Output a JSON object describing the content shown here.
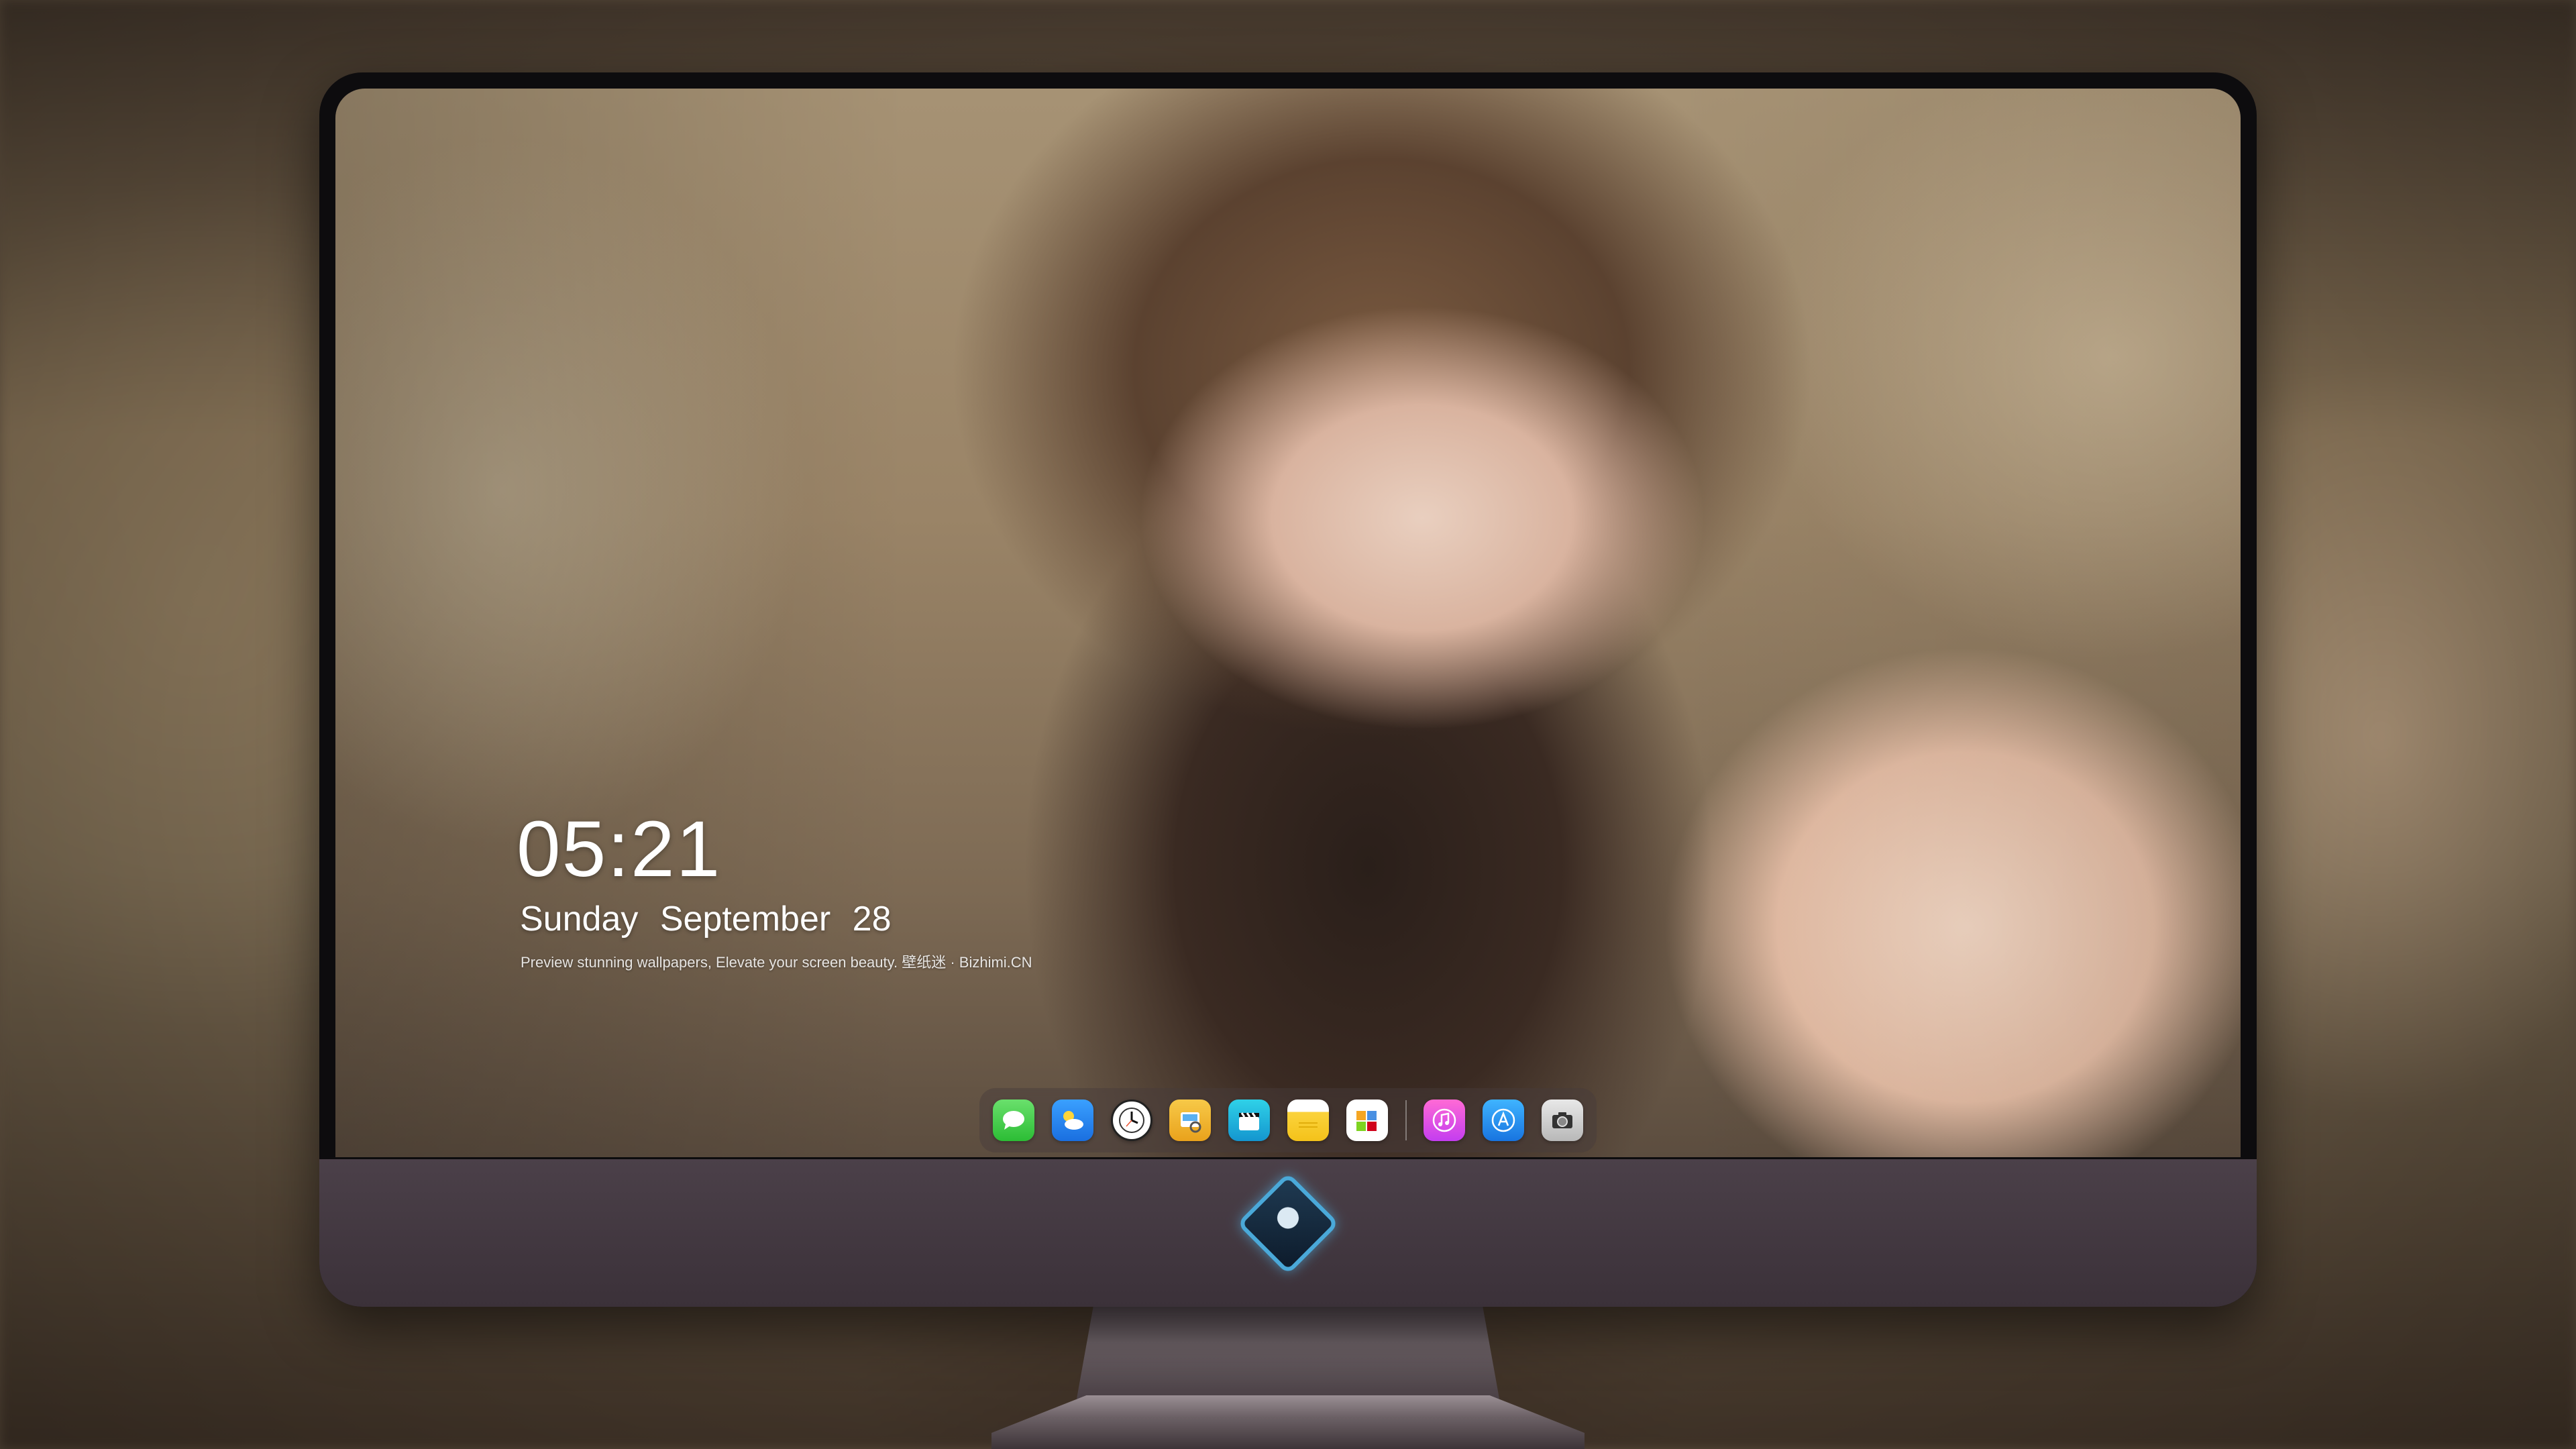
{
  "lockscreen": {
    "time": "05:21",
    "weekday": "Sunday",
    "month": "September",
    "day": "28",
    "tagline": "Preview stunning wallpapers, Elevate your screen beauty. 壁纸迷 · Bizhimi.CN"
  },
  "dock": {
    "apps": [
      {
        "name": "Messages",
        "icon": "messages-icon"
      },
      {
        "name": "Weather",
        "icon": "weather-icon"
      },
      {
        "name": "Clock",
        "icon": "clock-icon"
      },
      {
        "name": "Preview",
        "icon": "preview-icon"
      },
      {
        "name": "Clips",
        "icon": "clapperboard-icon"
      },
      {
        "name": "Notes",
        "icon": "notes-icon"
      },
      {
        "name": "Photos",
        "icon": "photos-icon"
      },
      {
        "name": "Music",
        "icon": "music-icon"
      },
      {
        "name": "App Store",
        "icon": "app-store-icon"
      },
      {
        "name": "Camera",
        "icon": "camera-icon"
      }
    ]
  },
  "monitor": {
    "logo": "monitor-brand-logo"
  },
  "colors": {
    "monitor_bezel": "#0d0c0e",
    "monitor_chin": "#4b4049",
    "dock_background": "rgba(70,60,60,0.45)",
    "clock_text": "#ffffff"
  }
}
